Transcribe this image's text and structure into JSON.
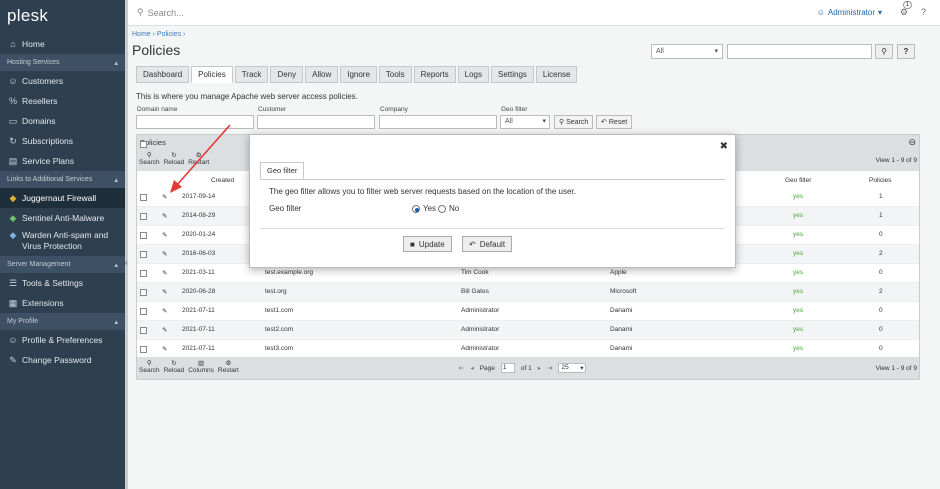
{
  "sidebar": {
    "logo": "plesk",
    "items_top": [
      {
        "label": "Home",
        "icon": "house"
      }
    ],
    "sections": [
      {
        "title": "Hosting Services",
        "items": [
          {
            "label": "Customers",
            "icon": "user"
          },
          {
            "label": "Resellers",
            "icon": "percent"
          },
          {
            "label": "Domains",
            "icon": "window"
          },
          {
            "label": "Subscriptions",
            "icon": "refresh"
          },
          {
            "label": "Service Plans",
            "icon": "document"
          }
        ]
      },
      {
        "title": "Links to Additional Services",
        "items": [
          {
            "label": "Juggernaut Firewall",
            "icon": "shield",
            "active": true
          },
          {
            "label": "Sentinel Anti-Malware",
            "icon": "bolt"
          },
          {
            "label": "Warden Anti-spam and Virus Protection",
            "icon": "mail"
          }
        ]
      },
      {
        "title": "Server Management",
        "items": [
          {
            "label": "Tools & Settings",
            "icon": "sliders"
          },
          {
            "label": "Extensions",
            "icon": "grid"
          }
        ]
      },
      {
        "title": "My Profile",
        "items": [
          {
            "label": "Profile & Preferences",
            "icon": "user"
          },
          {
            "label": "Change Password",
            "icon": "pencil"
          }
        ]
      }
    ]
  },
  "topbar": {
    "search_placeholder": "Search...",
    "user": "Administrator",
    "notifications": "1"
  },
  "breadcrumb": {
    "home": "Home",
    "current": "Policies"
  },
  "page_title": "Policies",
  "top_filter": {
    "select": "All"
  },
  "tabs": [
    "Dashboard",
    "Policies",
    "Track",
    "Deny",
    "Allow",
    "Ignore",
    "Tools",
    "Reports",
    "Logs",
    "Settings",
    "License"
  ],
  "description": "This is where you manage Apache web server access policies.",
  "filters": {
    "domain_label": "Domain name",
    "customer_label": "Customer",
    "company_label": "Company",
    "geo_label": "Geo filter",
    "geo_value": "All",
    "search_btn": "Search",
    "reset_btn": "Reset"
  },
  "grid": {
    "title": "Policies",
    "tools": [
      "Search",
      "Reload",
      "Restart"
    ],
    "footer_tools": [
      "Search",
      "Reload",
      "Columns",
      "Restart"
    ],
    "count": "View 1 - 9 of 9",
    "headers": {
      "created": "Created",
      "geo": "Geo filter",
      "policies": "Policies"
    },
    "rows": [
      {
        "created": "2017-09-14",
        "domain": "",
        "customer": "",
        "company": "",
        "geo": "yes",
        "policies": "1"
      },
      {
        "created": "2014-08-29",
        "domain": "",
        "customer": "",
        "company": "",
        "geo": "yes",
        "policies": "1"
      },
      {
        "created": "2020-01-24",
        "domain": "",
        "customer": "",
        "company": "",
        "geo": "yes",
        "policies": "0"
      },
      {
        "created": "2016-06-03",
        "domain": "",
        "customer": "",
        "company": "",
        "geo": "yes",
        "policies": "2"
      },
      {
        "created": "2021-03-11",
        "domain": "test.example.org",
        "customer": "Tim Cook",
        "company": "Apple",
        "geo": "yes",
        "policies": "0"
      },
      {
        "created": "2020-06-28",
        "domain": "test.org",
        "customer": "Bill Gates",
        "company": "Microsoft",
        "geo": "yes",
        "policies": "2"
      },
      {
        "created": "2021-07-11",
        "domain": "test1.com",
        "customer": "Administrator",
        "company": "Danami",
        "geo": "yes",
        "policies": "0"
      },
      {
        "created": "2021-07-11",
        "domain": "test2.com",
        "customer": "Administrator",
        "company": "Danami",
        "geo": "yes",
        "policies": "0"
      },
      {
        "created": "2021-07-11",
        "domain": "test3.com",
        "customer": "Administrator",
        "company": "Danami",
        "geo": "yes",
        "policies": "0"
      }
    ],
    "pager": {
      "page_label": "Page",
      "page": "1",
      "of": "of 1",
      "per_page": "25"
    }
  },
  "modal": {
    "tab": "Geo filter",
    "description": "The geo filter allows you to filter web server requests based on the location of the user.",
    "field_label": "Geo filter",
    "yes": "Yes",
    "no": "No",
    "selected": "yes",
    "update_btn": "Update",
    "default_btn": "Default"
  },
  "colors": {
    "sidebar": "#2e3f50",
    "accent": "#3a7bbd",
    "arrow": "#e53935",
    "geo_yes": "#4aa33b"
  }
}
